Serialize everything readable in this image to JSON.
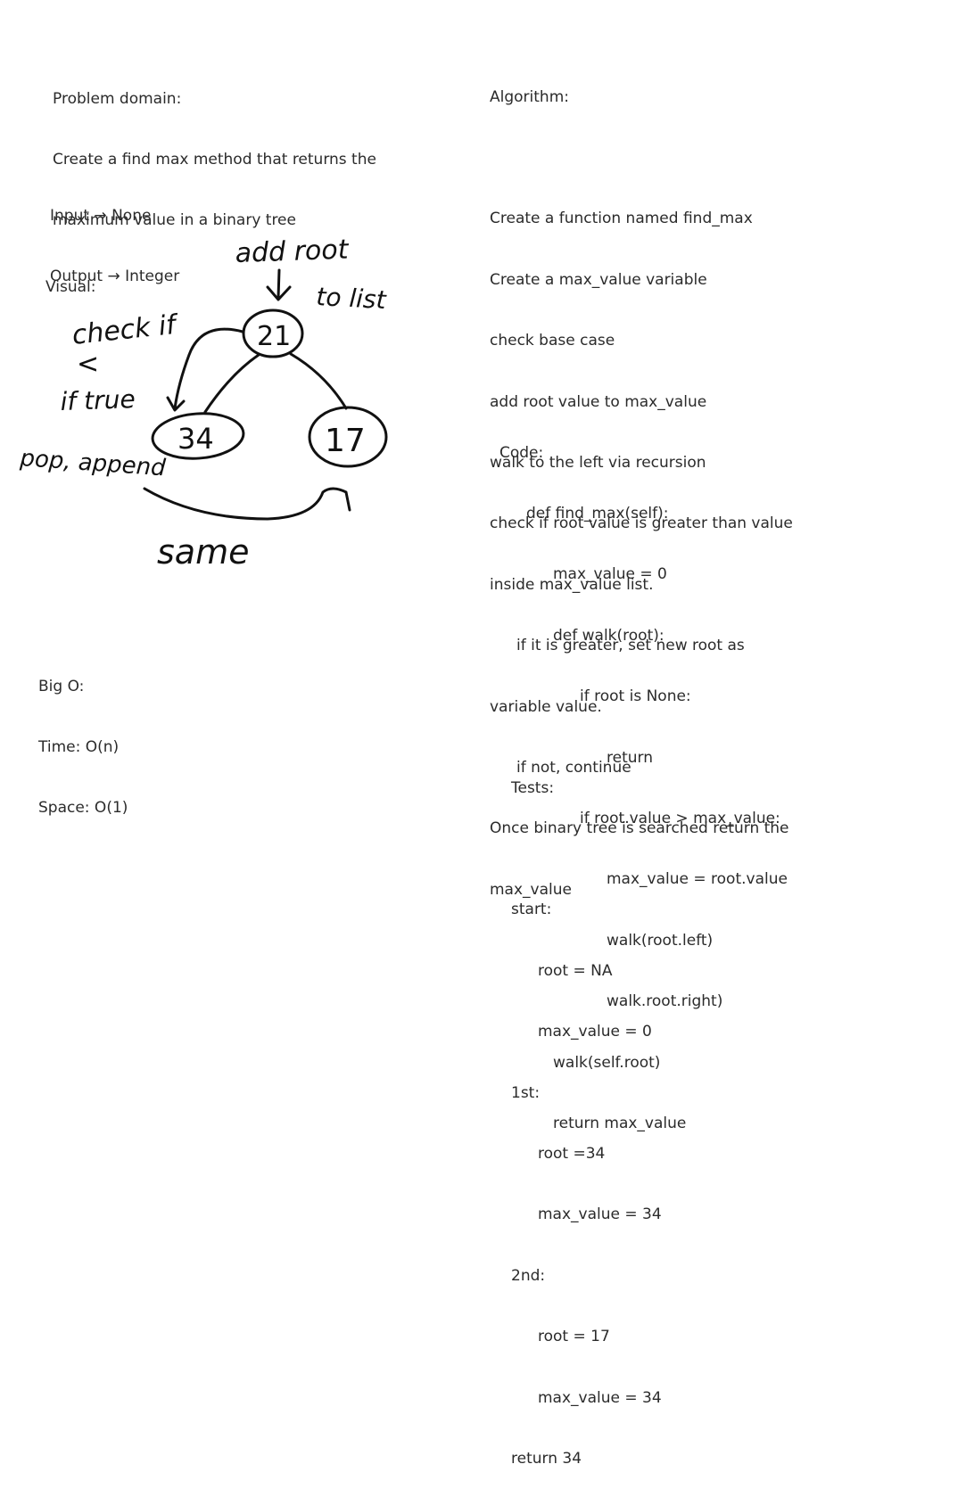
{
  "problem_domain": {
    "heading": "Problem domain:",
    "lines": [
      "Create a find max method that returns the",
      "maximum value in a binary tree"
    ]
  },
  "io": {
    "input": "Input → None",
    "output": "Output → Integer"
  },
  "visual": {
    "heading": "Visual:",
    "annotations": {
      "add_root_line1": "add root",
      "add_root_line2": "to list",
      "check_if": "check if",
      "less_than": "<",
      "if_true": "if true",
      "pop_append": "pop, append",
      "same": "same"
    },
    "nodes": {
      "root": "21",
      "left": "34",
      "right": "17"
    }
  },
  "big_o": {
    "heading": "Big O:",
    "time": "Time: O(n)",
    "space": "Space: O(1)"
  },
  "algorithm": {
    "heading": "Algorithm:",
    "lines": [
      {
        "text": "",
        "indent": 0
      },
      {
        "text": "Create a function named find_max",
        "indent": 0
      },
      {
        "text": "Create a max_value variable",
        "indent": 0
      },
      {
        "text": "check base case",
        "indent": 0
      },
      {
        "text": "add root value to max_value",
        "indent": 0
      },
      {
        "text": "walk to the left via recursion",
        "indent": 0
      },
      {
        "text": "check if root value is greater than value",
        "indent": 0
      },
      {
        "text": "inside max_value list.",
        "indent": 0
      },
      {
        "text": "if it is greater, set new root as",
        "indent": 1
      },
      {
        "text": "variable value.",
        "indent": 0
      },
      {
        "text": "if not, continue",
        "indent": 1
      },
      {
        "text": "Once binary tree is searched return the",
        "indent": 0
      },
      {
        "text": "max_value",
        "indent": 0
      }
    ]
  },
  "code": {
    "heading": "Code:",
    "lines": [
      {
        "text": "def find_max(self):",
        "indent": 1
      },
      {
        "text": "max_value = 0",
        "indent": 2
      },
      {
        "text": "def walk(root):",
        "indent": 2
      },
      {
        "text": "if root is None:",
        "indent": 3
      },
      {
        "text": "return",
        "indent": 4
      },
      {
        "text": "if root.value > max_value:",
        "indent": 3
      },
      {
        "text": "max_value = root.value",
        "indent": 4
      },
      {
        "text": "walk(root.left)",
        "indent": 4
      },
      {
        "text": "walk.root.right)",
        "indent": 4
      },
      {
        "text": "walk(self.root)",
        "indent": 2
      },
      {
        "text": "return max_value",
        "indent": 2
      }
    ]
  },
  "tests": {
    "heading": "Tests:",
    "lines": [
      {
        "text": "",
        "indent": 0
      },
      {
        "text": "start:",
        "indent": 0
      },
      {
        "text": "root = NA",
        "indent": 1
      },
      {
        "text": "max_value = 0",
        "indent": 1
      },
      {
        "text": "1st:",
        "indent": 0
      },
      {
        "text": "root =34",
        "indent": 1
      },
      {
        "text": "max_value = 34",
        "indent": 1
      },
      {
        "text": "2nd:",
        "indent": 0
      },
      {
        "text": "root = 17",
        "indent": 1
      },
      {
        "text": "max_value = 34",
        "indent": 1
      },
      {
        "text": "return 34",
        "indent": 0
      }
    ]
  }
}
